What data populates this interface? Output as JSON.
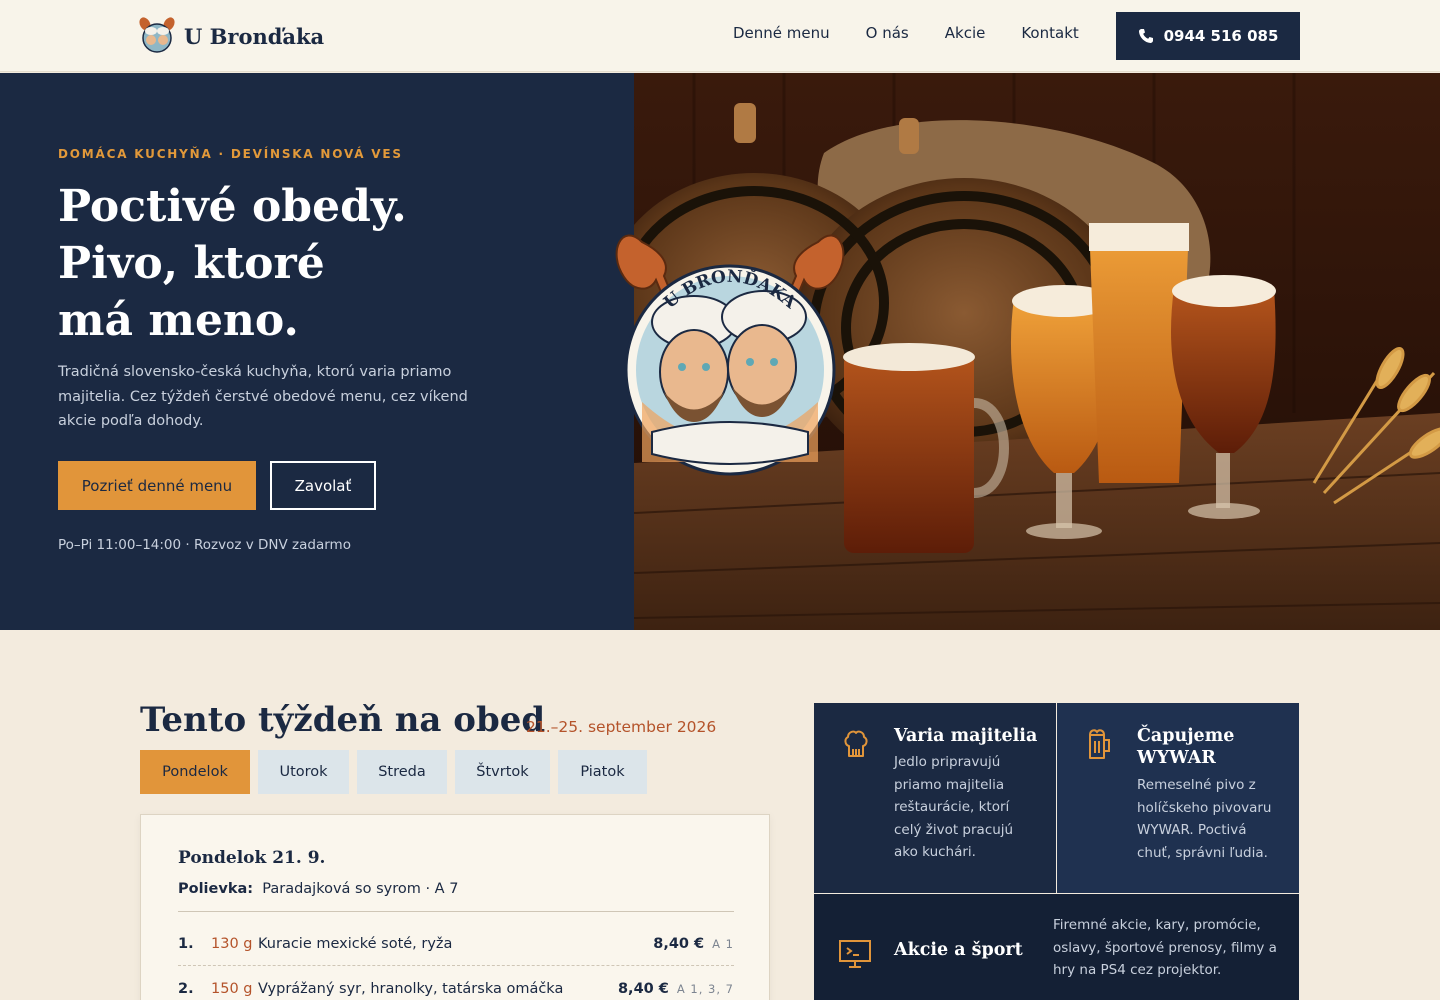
{
  "header": {
    "brand": "U Bronďaka",
    "nav": [
      "Denné menu",
      "O nás",
      "Akcie",
      "Kontakt"
    ],
    "phone": "0944 516 085"
  },
  "hero": {
    "eyebrow": "DOMÁCA KUCHYŇA · DEVÍNSKA NOVÁ VES",
    "title_lines": [
      "Poctivé obedy.",
      "Pivo, ktoré",
      "má meno."
    ],
    "description": "Tradičná slovensko-česká kuchyňa, ktorú varia priamo majitelia. Cez týždeň čerstvé obedové menu, cez víkend akcie podľa dohody.",
    "primary_button": "Pozrieť denné menu",
    "secondary_button": "Zavolať",
    "hours": "Po–Pi 11:00–14:00 · Rozvoz v DNV zadarmo",
    "badge_text": "U BRONĎAKA"
  },
  "menu": {
    "title": "Tento týždeň na obed",
    "date_range": "21.–25. september 2026",
    "tabs": [
      "Pondelok",
      "Utorok",
      "Streda",
      "Štvrtok",
      "Piatok"
    ],
    "active_tab": 0,
    "day_title": "Pondelok 21. 9.",
    "soup_label": "Polievka:",
    "soup": "Paradajková so syrom · A 7",
    "items": [
      {
        "num": "1.",
        "weight": "130 g",
        "dish": "Kuracie mexické soté, ryža",
        "price": "8,40 €",
        "allergens": "A 1"
      },
      {
        "num": "2.",
        "weight": "150 g",
        "dish": "Vyprážaný syr, hranolky, tatárska omáčka",
        "price": "8,40 €",
        "allergens": "A 1, 3, 7"
      }
    ]
  },
  "cards": [
    {
      "title": "Varia majitelia",
      "text": "Jedlo pripravujú priamo majitelia reštaurácie, ktorí celý život pracujú ako kuchári.",
      "icon": "chef-hat-icon"
    },
    {
      "title": "Čapujeme WYWAR",
      "text": "Remeselné pivo z holíčskeho pivovaru WYWAR. Poctivá chuť, správni ľudia.",
      "icon": "beer-mug-icon"
    },
    {
      "title": "Akcie a šport",
      "text": "Firemné akcie, kary, promócie, oslavy, športové prenosy, filmy a hry na PS4 cez projektor.",
      "icon": "projector-screen-icon"
    }
  ],
  "colors": {
    "navy": "#1b2942",
    "accent": "#e1953a",
    "price_accent": "#b4532a",
    "cream": "#f3ebde"
  }
}
